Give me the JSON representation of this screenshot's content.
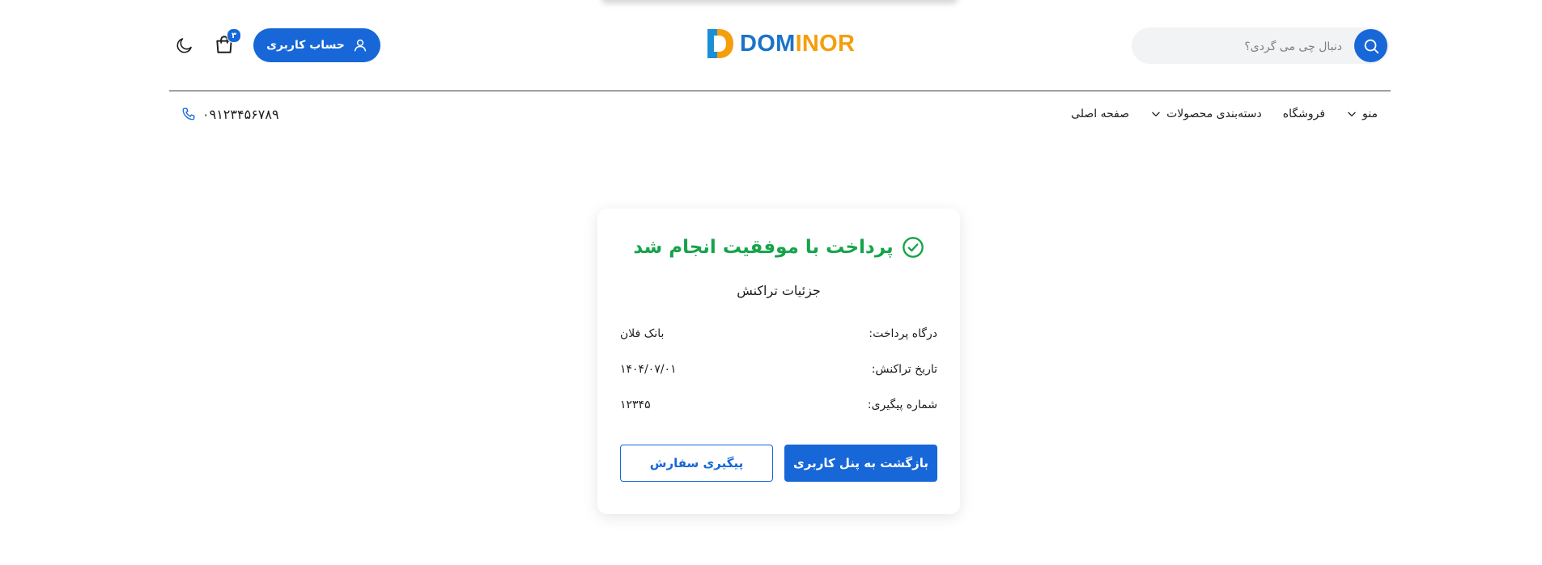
{
  "header": {
    "search": {
      "placeholder": "دنبال چی می گردی؟"
    },
    "logo": {
      "text_part1": "DOM",
      "text_part2": "INOR",
      "color_blue": "#1a73c8",
      "color_orange": "#f59e0b"
    },
    "account_button_label": "حساب کاربری",
    "cart_count": "۳"
  },
  "nav": {
    "items": [
      {
        "label": "صفحه اصلی",
        "has_dropdown": false
      },
      {
        "label": "دسته‌بندی محصولات",
        "has_dropdown": true
      },
      {
        "label": "فروشگاه",
        "has_dropdown": false
      },
      {
        "label": "منو",
        "has_dropdown": true
      }
    ],
    "phone": "۰۹۱۲۳۴۵۶۷۸۹"
  },
  "card": {
    "title": "پرداخت با موفقیت انجام شد",
    "subtitle": "جزئیات تراکنش",
    "details": [
      {
        "label": "درگاه پرداخت:",
        "value": "بانک فلان"
      },
      {
        "label": "تاریخ تراکنش:",
        "value": "۱۴۰۴/۰۷/۰۱"
      },
      {
        "label": "شماره پیگیری:",
        "value": "۱۲۳۴۵"
      }
    ],
    "primary_button": "بازگشت به پنل کاربری",
    "secondary_button": "پیگیری سفارش"
  },
  "colors": {
    "accent": "#1767d8",
    "success": "#16a34a"
  }
}
